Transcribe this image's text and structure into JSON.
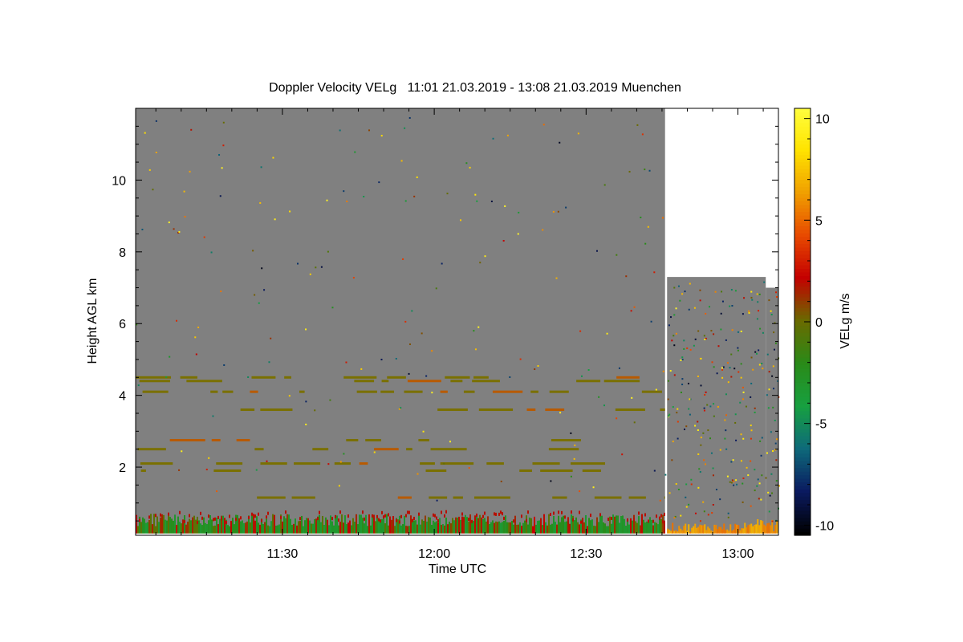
{
  "chart_data": {
    "type": "heatmap",
    "title": "Doppler Velocity VELg   11:01 21.03.2019 - 13:08 21.03.2019 Muenchen",
    "xlabel": "Time UTC",
    "ylabel": "Height AGL km",
    "colorbar_label": "VELg m/s",
    "x_ticks": [
      "11:30",
      "12:00",
      "12:30",
      "13:00"
    ],
    "x_tick_values_min": [
      690,
      720,
      750,
      780
    ],
    "xlim_min": [
      661,
      788
    ],
    "y_ticks": [
      2,
      4,
      6,
      8,
      10
    ],
    "ylim": [
      0.1,
      12.0
    ],
    "colorbar_ticks": [
      -10,
      -5,
      0,
      5,
      10
    ],
    "clim": [
      -10.5,
      10.5
    ],
    "colorscale": [
      "#000000",
      "#0a1a60",
      "#0e6a7a",
      "#17a040",
      "#2a8a18",
      "#6a6a00",
      "#c40000",
      "#e84a00",
      "#f0a000",
      "#ffe400",
      "#ffff40"
    ],
    "background_color": "#808080",
    "data_gap_min": [
      765.6,
      766.0
    ],
    "segments": [
      {
        "start_min": 661,
        "end_min": 765.6,
        "top_km": 12.0,
        "dominant_low_level": "green/red (-3 to +2 m/s)"
      },
      {
        "start_min": 766.0,
        "end_min": 785.5,
        "top_km": 7.3,
        "dominant_low_level": "orange (+5 to +7 m/s)"
      },
      {
        "start_min": 785.5,
        "end_min": 788,
        "top_km": 7.0,
        "dominant_low_level": "orange (+5 to +7 m/s)"
      }
    ],
    "echo_layers_km": [
      0.15,
      0.6,
      1.15,
      1.9,
      2.1,
      2.5,
      2.75,
      3.6,
      4.1,
      4.4,
      4.5
    ]
  }
}
